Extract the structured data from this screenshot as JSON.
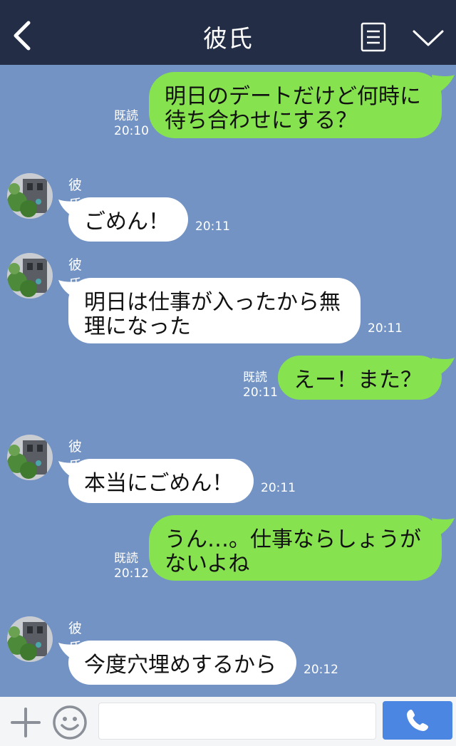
{
  "header": {
    "title": "彼氏",
    "back_icon": "chevron-left-icon",
    "menu_icon": "list-icon",
    "collapse_icon": "chevron-down-icon",
    "bg": "#232d46"
  },
  "chat": {
    "bg": "#7293c3",
    "messages": [
      {
        "from": "me",
        "lines": [
          "明日のデートだけど何時に",
          "待ち合わせにする？"
        ],
        "read": "既読",
        "time": "20:10"
      },
      {
        "from": "them",
        "name": "彼氏",
        "lines": [
          "ごめん！"
        ],
        "time": "20:11"
      },
      {
        "from": "them",
        "name": "彼氏",
        "lines": [
          "明日は仕事が入ったから無",
          "理になった"
        ],
        "time": "20:11"
      },
      {
        "from": "me",
        "lines": [
          "えー！また？"
        ],
        "read": "既読",
        "time": "20:11"
      },
      {
        "from": "them",
        "name": "彼氏",
        "lines": [
          "本当にごめん！"
        ],
        "time": "20:11"
      },
      {
        "from": "me",
        "lines": [
          "うん…。仕事ならしょうが",
          "ないよね"
        ],
        "read": "既読",
        "time": "20:12"
      },
      {
        "from": "them",
        "name": "彼氏",
        "lines": [
          "今度穴埋めするから"
        ],
        "time": "20:12"
      }
    ]
  },
  "footer": {
    "plus_icon": "plus-icon",
    "emoji_icon": "smile-icon",
    "input_value": "",
    "call_icon": "phone-icon",
    "call_bg": "#4b86e3"
  },
  "colors": {
    "my_bubble": "#86e24e",
    "their_bubble": "#ffffff"
  }
}
